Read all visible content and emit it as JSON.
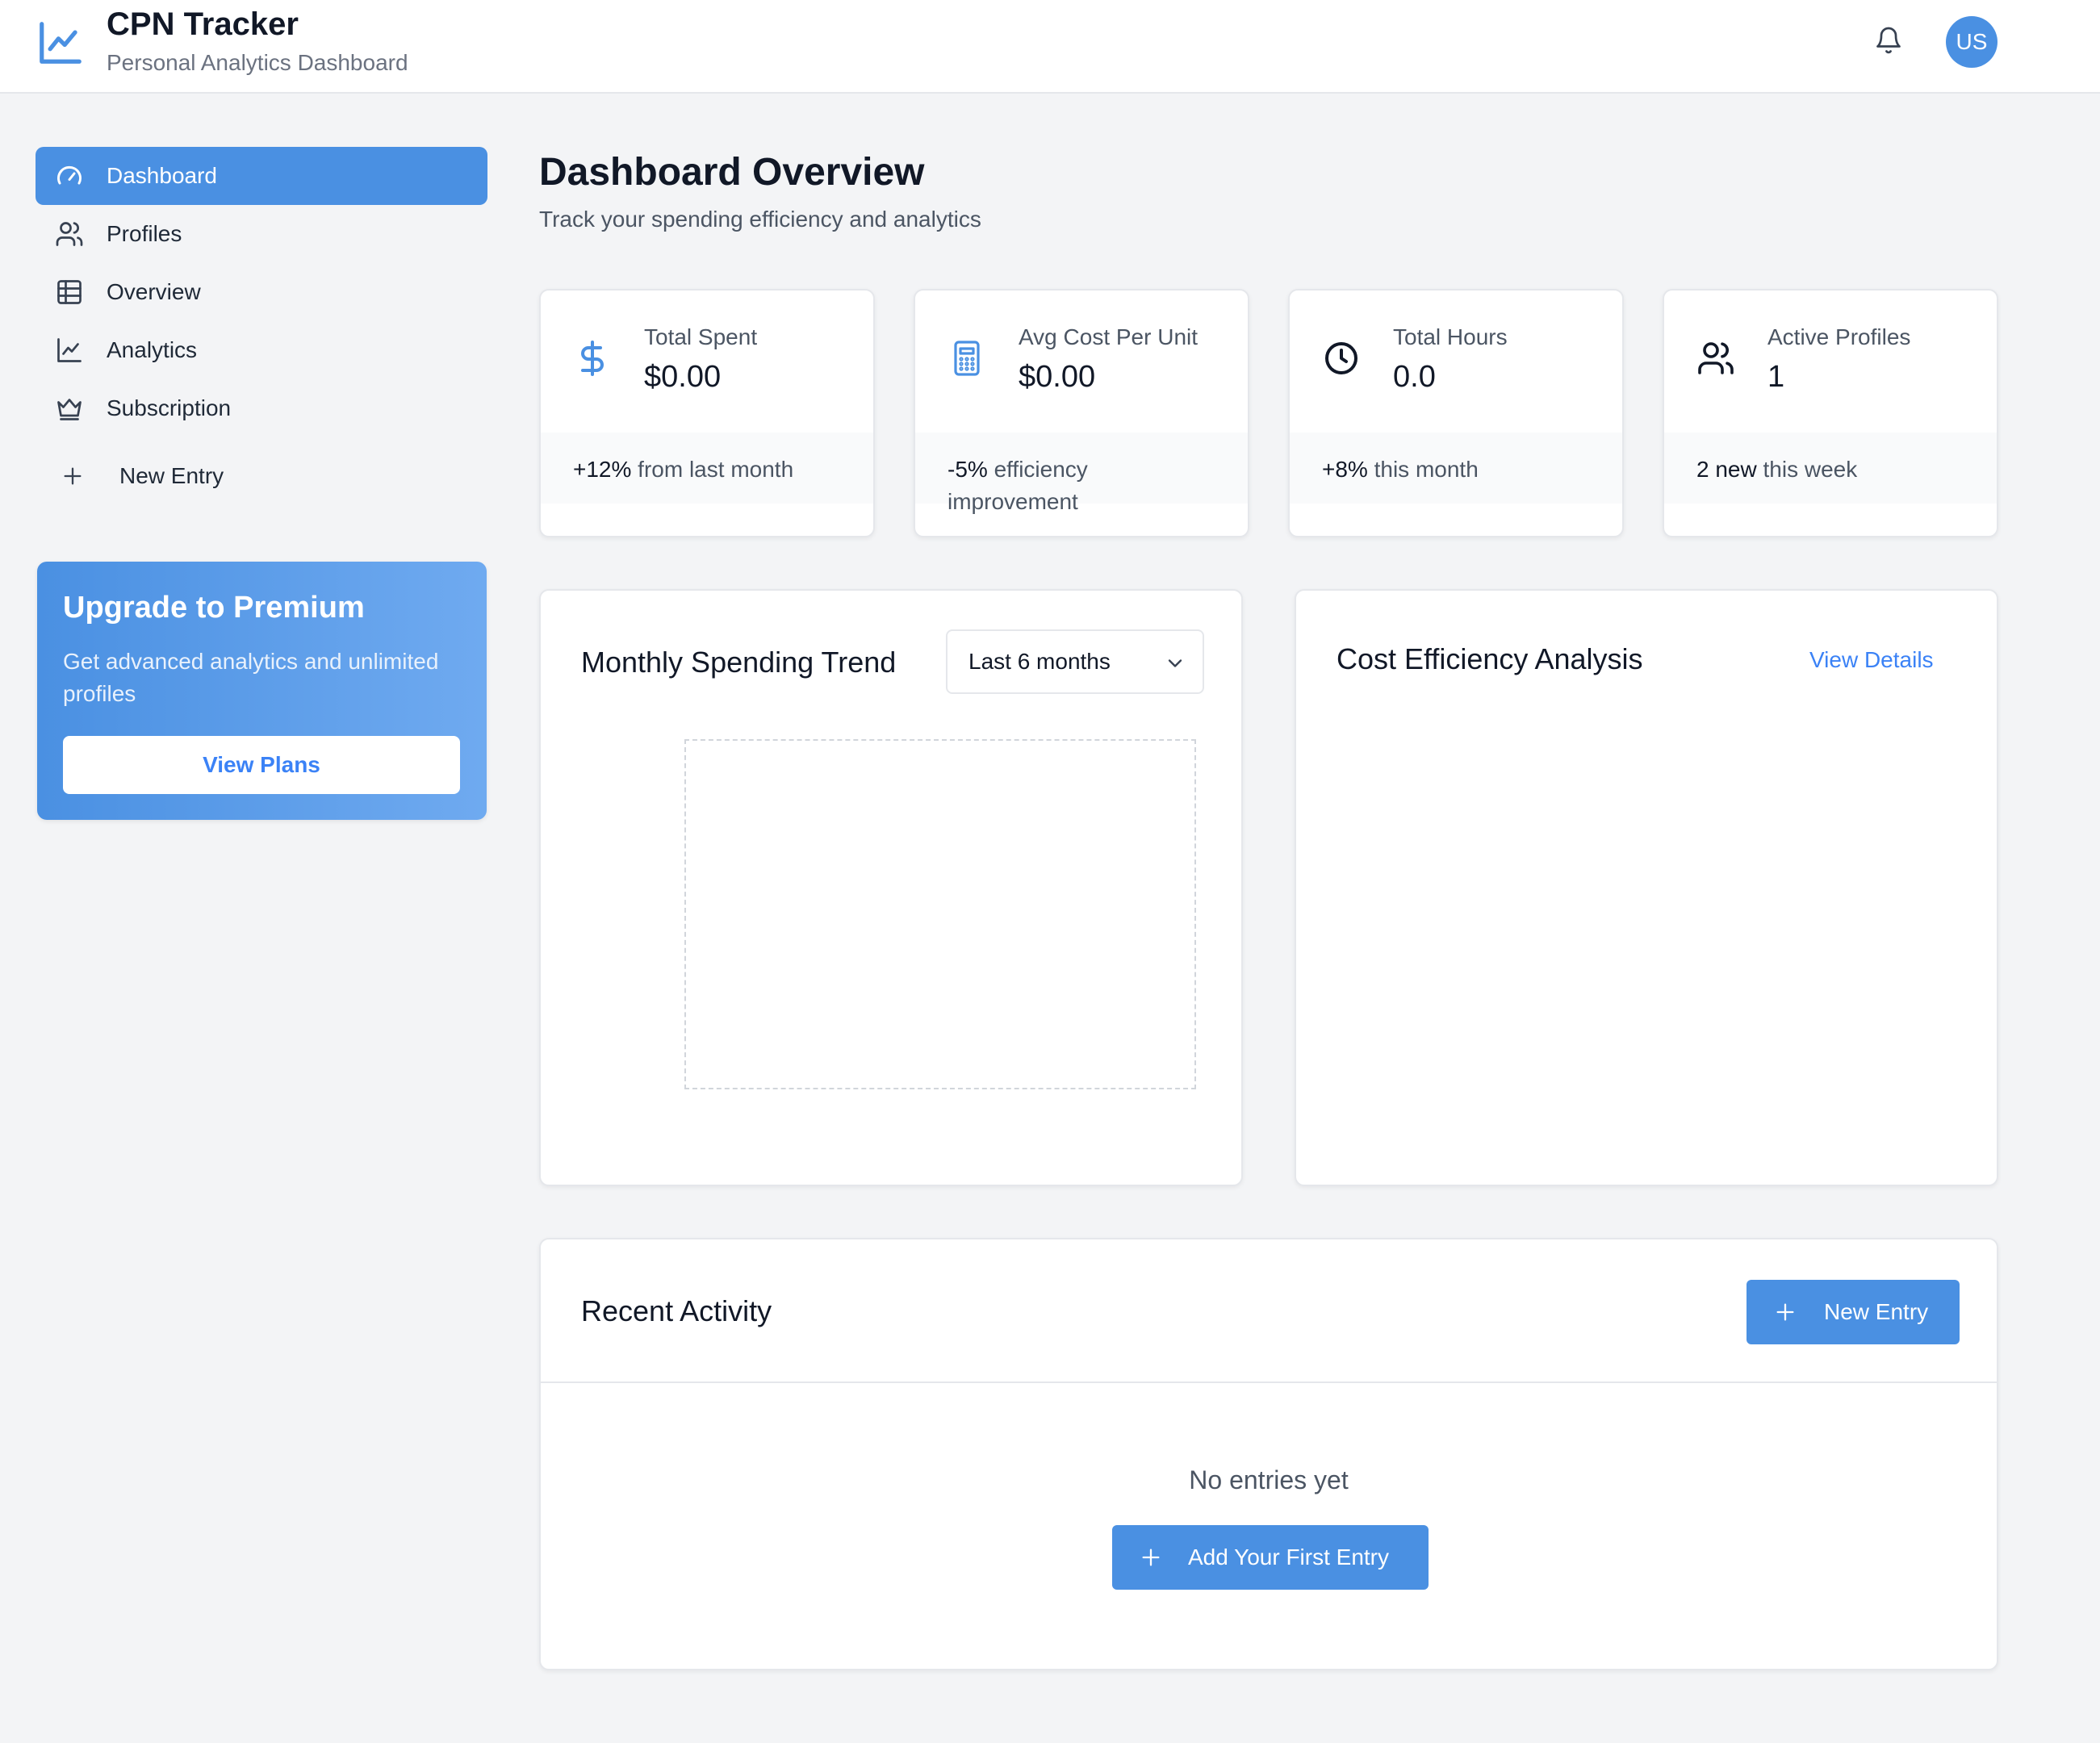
{
  "app": {
    "title": "CPN Tracker",
    "subtitle": "Personal Analytics Dashboard",
    "user_initials": "US",
    "accent_color": "#4a90e2"
  },
  "sidebar": {
    "items": [
      {
        "label": "Dashboard",
        "icon": "gauge-icon",
        "active": true
      },
      {
        "label": "Profiles",
        "icon": "users-icon"
      },
      {
        "label": "Overview",
        "icon": "table-icon"
      },
      {
        "label": "Analytics",
        "icon": "chart-line-icon"
      },
      {
        "label": "Subscription",
        "icon": "crown-icon"
      }
    ],
    "new_entry_label": "New Entry",
    "premium": {
      "title": "Upgrade to Premium",
      "text": "Get advanced analytics and unlimited profiles",
      "button": "View Plans"
    }
  },
  "main": {
    "title": "Dashboard Overview",
    "subtitle": "Track your spending efficiency and analytics",
    "stats": [
      {
        "label": "Total Spent",
        "value": "$0.00",
        "change": "+12%",
        "change_text": " from last month",
        "icon": "dollar-icon"
      },
      {
        "label": "Avg Cost Per Unit",
        "value": "$0.00",
        "change": "-5%",
        "change_text": " efficiency improvement",
        "icon": "calculator-icon"
      },
      {
        "label": "Total Hours",
        "value": "0.0",
        "change": "+8%",
        "change_text": " this month",
        "icon": "clock-icon"
      },
      {
        "label": "Active Profiles",
        "value": "1",
        "change": "2 new",
        "change_text": " this week",
        "icon": "users-icon"
      }
    ],
    "spending_trend": {
      "title": "Monthly Spending Trend",
      "range_selected": "Last 6 months"
    },
    "cost_efficiency": {
      "title": "Cost Efficiency Analysis",
      "link": "View Details"
    },
    "recent_activity": {
      "title": "Recent Activity",
      "new_entry_button": "New Entry",
      "empty_text": "No entries yet",
      "add_first_button": "Add Your First Entry"
    }
  }
}
